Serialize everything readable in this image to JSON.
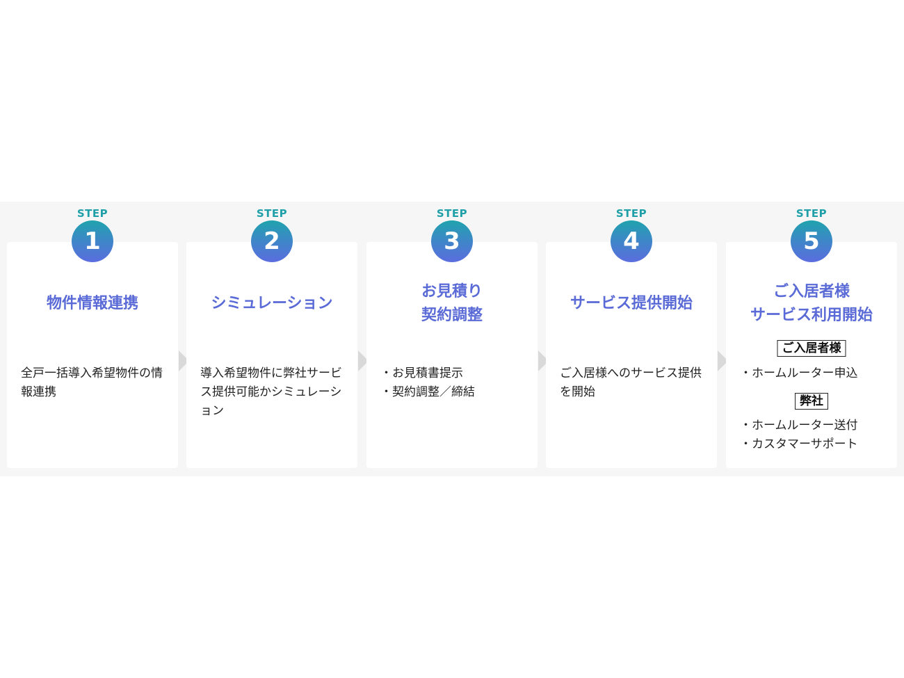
{
  "step_label": "STEP",
  "steps": [
    {
      "number": "1",
      "title": [
        "物件情報連携"
      ],
      "description": "全戸一括導入希望物件の情報連携"
    },
    {
      "number": "2",
      "title": [
        "シミュレーション"
      ],
      "description": "導入希望物件に弊社サービス提供可能かシミュレーション"
    },
    {
      "number": "3",
      "title": [
        "お見積り",
        "契約調整"
      ],
      "bullets": [
        "お見積書提示",
        "契約調整／締結"
      ]
    },
    {
      "number": "4",
      "title": [
        "サービス提供開始"
      ],
      "description": "ご入居様へのサービス提供を開始"
    },
    {
      "number": "5",
      "title": [
        "ご入居者様",
        "サービス利用開始"
      ],
      "groups": [
        {
          "tag": "ご入居者様",
          "bullets": [
            "ホームルーター申込"
          ]
        },
        {
          "tag": "弊社",
          "bullets": [
            "ホームルーター送付",
            "カスタマーサポート"
          ]
        }
      ]
    }
  ],
  "colors": {
    "accent_title": "#5a6ad6",
    "step_label": "#1fa0a8",
    "circle_gradient": [
      "#1fa3ad",
      "#5b6ddf"
    ],
    "band_background": "#f6f6f6",
    "arrow": "#d9d9d9"
  }
}
